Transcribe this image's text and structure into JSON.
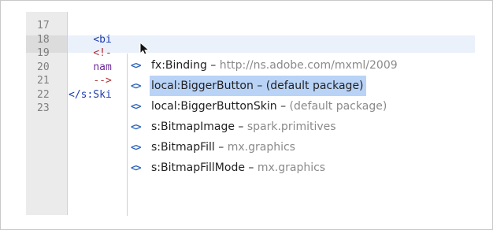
{
  "editor": {
    "line_numbers": [
      "17",
      "18",
      "19",
      "20",
      "21",
      "22",
      "23"
    ],
    "lines": [
      {
        "indent": "",
        "tokens": []
      },
      {
        "indent": "    ",
        "tokens": [
          {
            "kind": "tag",
            "text": "<bi"
          }
        ]
      },
      {
        "indent": "    ",
        "tokens": [
          {
            "kind": "comment",
            "text": "<!-"
          }
        ]
      },
      {
        "indent": "    ",
        "tokens": [
          {
            "kind": "attr",
            "text": "nam"
          }
        ]
      },
      {
        "indent": "    ",
        "tokens": [
          {
            "kind": "comment",
            "text": "-->"
          }
        ]
      },
      {
        "indent": "",
        "tokens": [
          {
            "kind": "tag",
            "text": "</s:Ski"
          }
        ]
      },
      {
        "indent": "",
        "tokens": []
      }
    ]
  },
  "autocomplete": {
    "selected_index": 1,
    "items": [
      {
        "icon": "<>",
        "name": "fx:Binding",
        "sep": " – ",
        "package": "http://ns.adobe.com/mxml/2009"
      },
      {
        "icon": "<>",
        "name": "local:BiggerButton",
        "sep": " – ",
        "package": "(default package)"
      },
      {
        "icon": "<>",
        "name": "local:BiggerButtonSkin",
        "sep": " – ",
        "package": "(default package)"
      },
      {
        "icon": "<>",
        "name": "s:BitmapImage",
        "sep": " – ",
        "package": "spark.primitives"
      },
      {
        "icon": "<>",
        "name": "s:BitmapFill",
        "sep": " – ",
        "package": "mx.graphics"
      },
      {
        "icon": "<>",
        "name": "s:BitmapFillMode",
        "sep": " – ",
        "package": "mx.graphics"
      }
    ]
  },
  "colors": {
    "tag": "#1f3fb0",
    "comment": "#b03030",
    "attribute": "#6b2a9a",
    "selection": "#b9d3f7",
    "current_line": "#eaf1fb"
  }
}
